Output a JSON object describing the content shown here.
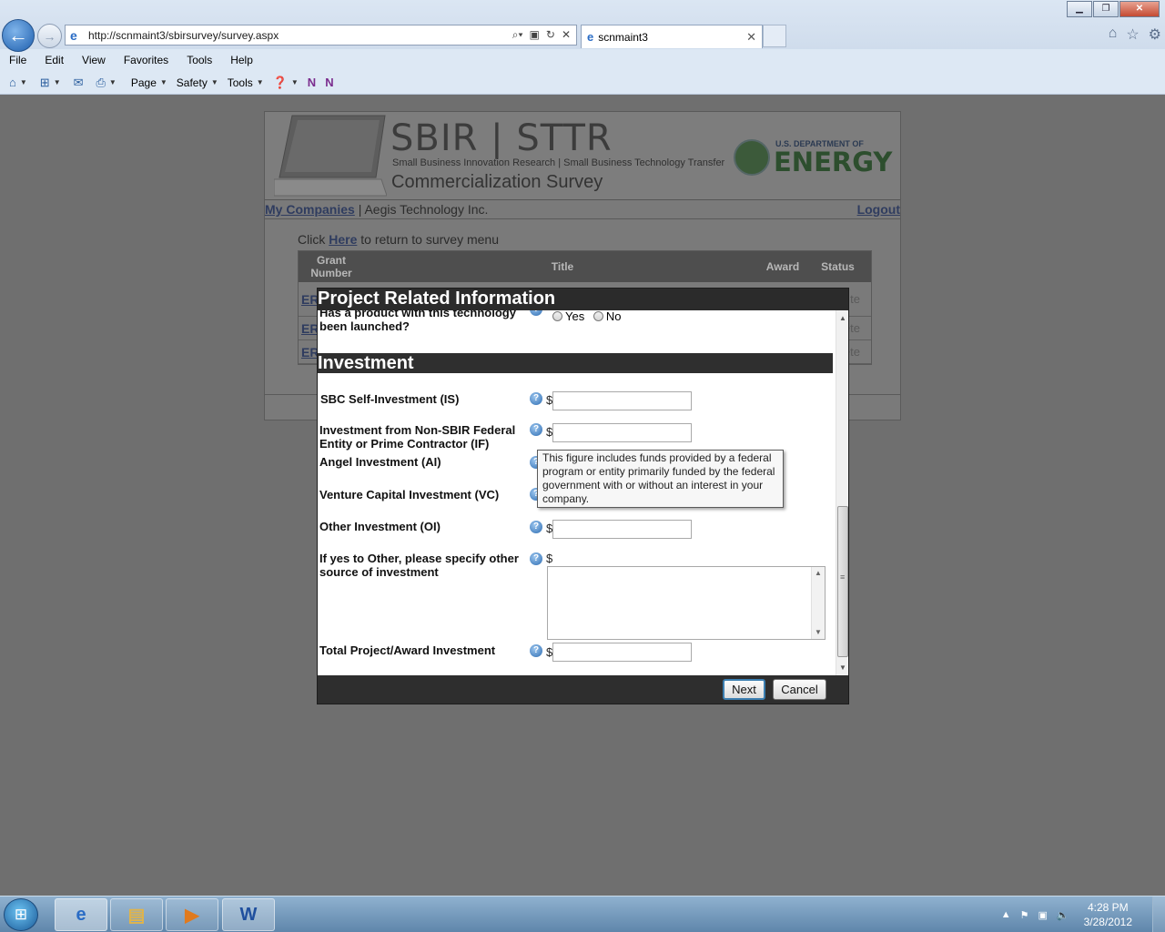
{
  "browser": {
    "url": "http://scnmaint3/sbirsurvey/survey.aspx",
    "tab_title": "scnmaint3",
    "menu": [
      "File",
      "Edit",
      "View",
      "Favorites",
      "Tools",
      "Help"
    ],
    "commands": {
      "page": "Page",
      "safety": "Safety",
      "tools": "Tools"
    }
  },
  "site": {
    "brand_title": "SBIR | STTR",
    "brand_subtitle": "Small Business Innovation Research | Small Business Technology Transfer",
    "brand_survey": "Commercialization Survey",
    "doe_top": "U.S. DEPARTMENT OF",
    "doe_main": "ENERGY",
    "nav": {
      "my_companies": "My Companies",
      "separator": " | ",
      "company": "Aegis Technology Inc.",
      "logout": "Logout"
    },
    "return_line": {
      "prefix": "Click ",
      "link": "Here",
      "suffix": " to return to survey menu"
    },
    "table": {
      "headers": {
        "grant": "Grant\nNumber",
        "title": "Title",
        "award": "Award",
        "status": "Status"
      },
      "rows": [
        {
          "grant": "ER",
          "status": "te"
        },
        {
          "grant": "ER",
          "status": "lete"
        },
        {
          "grant": "ER",
          "status": "lete"
        }
      ]
    }
  },
  "modal": {
    "title": "Project Related Information",
    "launched_question": "Has a product with this technology\nbeen launched?",
    "yes": "Yes",
    "no": "No",
    "section": "Investment",
    "currency": "$",
    "fields": {
      "is": "SBC Self-Investment (IS)",
      "if": "Investment from Non-SBIR Federal\nEntity or Prime Contractor (IF)",
      "ai": "Angel Investment (AI)",
      "vc": "Venture Capital Investment (VC)",
      "oi": "Other Investment (OI)",
      "other_specify": "If yes to Other, please specify other\nsource of investment",
      "total": "Total Project/Award Investment"
    },
    "tooltip": "This figure includes funds provided by a federal program or entity primarily funded by the federal government with or without an interest in your company.",
    "next": "Next",
    "cancel": "Cancel"
  },
  "taskbar": {
    "time": "4:28 PM",
    "date": "3/28/2012"
  }
}
